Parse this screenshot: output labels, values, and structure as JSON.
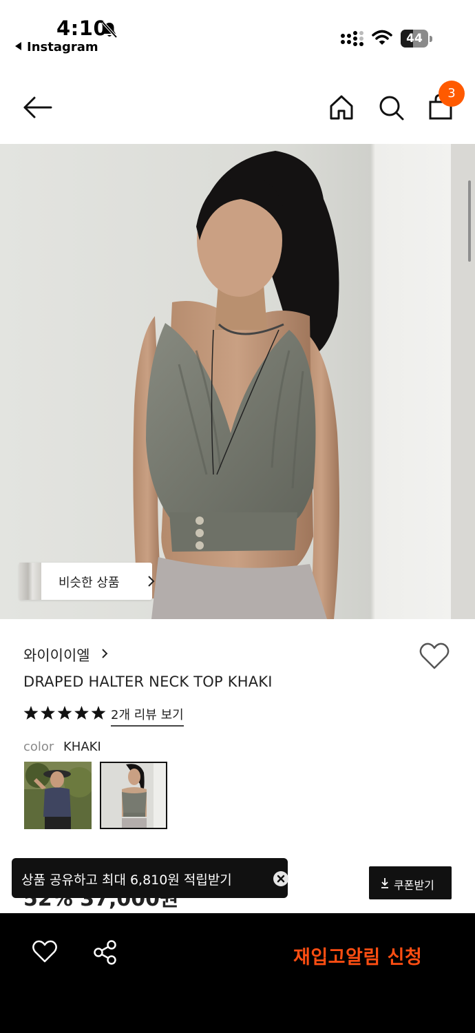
{
  "status_bar": {
    "time": "4:10",
    "back_app": "Instagram",
    "battery": "44"
  },
  "header": {
    "cart_count": "3"
  },
  "hero": {
    "similar_label": "비슷한 상품"
  },
  "product": {
    "brand": "와이이이엘",
    "name": "DRAPED HALTER NECK TOP KHAKI",
    "rating": 5,
    "review_link": "2개 리뷰 보기",
    "color_label": "color",
    "color_value": "KHAKI",
    "price_partial": "52% 37,000원"
  },
  "toast": {
    "text": "상품 공유하고 최대 6,810원 적립받기"
  },
  "coupon": {
    "label": "쿠폰받기"
  },
  "bottom_bar": {
    "restock_label": "재입고알림 신청"
  },
  "colors": {
    "accent": "#ff5a00",
    "restock": "#ff4e12",
    "khaki_top": "#7a7d72"
  },
  "icons": [
    "bell-slash-icon",
    "signal-icon",
    "wifi-icon",
    "battery-icon",
    "back-arrow-icon",
    "home-icon",
    "search-icon",
    "shopping-bag-icon",
    "chevron-right-icon",
    "heart-icon",
    "star-icon",
    "close-circle-icon",
    "download-icon",
    "share-icon"
  ]
}
